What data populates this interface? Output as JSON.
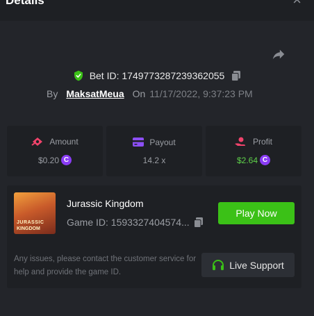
{
  "header": {
    "title": "Details",
    "close_glyph": "×"
  },
  "bet": {
    "id_label": "Bet ID: 1749773287239362055"
  },
  "byline": {
    "by_label": "By",
    "username": "MaksatMeua",
    "on_label": "On",
    "datetime": "11/17/2022, 9:37:23 PM"
  },
  "stats": {
    "amount": {
      "label": "Amount",
      "value": "$0.20"
    },
    "payout": {
      "label": "Payout",
      "value": "14.2 x"
    },
    "profit": {
      "label": "Profit",
      "value": "$2.64"
    }
  },
  "coin_glyph": "C",
  "game": {
    "thumb_line1": "JURASSIC",
    "thumb_line2": "KINGDOM",
    "name": "Jurassic Kingdom",
    "id_label": "Game ID: 1593327404574...",
    "play_label": "Play Now"
  },
  "support": {
    "note": "Any issues, please contact the customer service for help and provide the game ID.",
    "button_label": "Live Support"
  },
  "colors": {
    "accent_green": "#3bc117",
    "profit_green": "#5fd14a",
    "coin_purple": "#8a3cf5",
    "amount_pink": "#f0436b",
    "payout_purple": "#8c4ff5",
    "profit_red": "#f0436b"
  }
}
